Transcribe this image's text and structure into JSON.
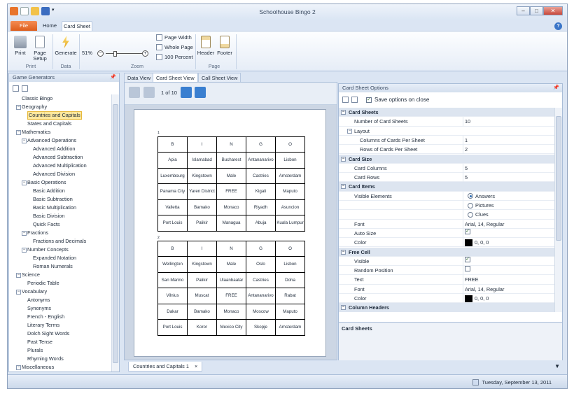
{
  "app": {
    "title": "Schoolhouse Bingo 2"
  },
  "window_controls": {
    "minimize": "–",
    "maximize": "□",
    "close": "✕"
  },
  "tabs": [
    "File",
    "Home",
    "Card Sheet"
  ],
  "help_label": "?",
  "ribbon": {
    "print": "Print",
    "page_setup": "Page Setup",
    "generate": "Generate",
    "zoom_value": "51%",
    "page_width": "Page Width",
    "whole_page": "Whole Page",
    "hundred": "100 Percent",
    "header": "Header",
    "footer": "Footer",
    "groups": {
      "print": "Print",
      "data": "Data",
      "zoom": "Zoom",
      "page": "Page"
    }
  },
  "left_panel": {
    "title": "Game Generators",
    "pin": "ᵖ",
    "tree": [
      {
        "label": "Classic Bingo",
        "level": 0,
        "toggle": ""
      },
      {
        "label": "Geography",
        "level": 0,
        "toggle": "−"
      },
      {
        "label": "Countries and Capitals",
        "level": 1,
        "toggle": "",
        "selected": true
      },
      {
        "label": "States and Capitals",
        "level": 1,
        "toggle": ""
      },
      {
        "label": "Mathematics",
        "level": 0,
        "toggle": "−"
      },
      {
        "label": "Advanced Operations",
        "level": 1,
        "toggle": "−"
      },
      {
        "label": "Advanced Addition",
        "level": 2,
        "toggle": ""
      },
      {
        "label": "Advanced Subtraction",
        "level": 2,
        "toggle": ""
      },
      {
        "label": "Advanced Multiplication",
        "level": 2,
        "toggle": ""
      },
      {
        "label": "Advanced Division",
        "level": 2,
        "toggle": ""
      },
      {
        "label": "Basic Operations",
        "level": 1,
        "toggle": "−"
      },
      {
        "label": "Basic Addition",
        "level": 2,
        "toggle": ""
      },
      {
        "label": "Basic Subtraction",
        "level": 2,
        "toggle": ""
      },
      {
        "label": "Basic Multiplication",
        "level": 2,
        "toggle": ""
      },
      {
        "label": "Basic Division",
        "level": 2,
        "toggle": ""
      },
      {
        "label": "Quick Facts",
        "level": 2,
        "toggle": ""
      },
      {
        "label": "Fractions",
        "level": 1,
        "toggle": "−"
      },
      {
        "label": "Fractions and Decimals",
        "level": 2,
        "toggle": ""
      },
      {
        "label": "Number Concepts",
        "level": 1,
        "toggle": "−"
      },
      {
        "label": "Expanded Notation",
        "level": 2,
        "toggle": ""
      },
      {
        "label": "Roman Numerals",
        "level": 2,
        "toggle": ""
      },
      {
        "label": "Science",
        "level": 0,
        "toggle": "−"
      },
      {
        "label": "Periodic Table",
        "level": 1,
        "toggle": ""
      },
      {
        "label": "Vocabulary",
        "level": 0,
        "toggle": "−"
      },
      {
        "label": "Antonyms",
        "level": 1,
        "toggle": ""
      },
      {
        "label": "Synonyms",
        "level": 1,
        "toggle": ""
      },
      {
        "label": "French - English",
        "level": 1,
        "toggle": ""
      },
      {
        "label": "Literary Terms",
        "level": 1,
        "toggle": ""
      },
      {
        "label": "Dolch Sight Words",
        "level": 1,
        "toggle": ""
      },
      {
        "label": "Past Tense",
        "level": 1,
        "toggle": ""
      },
      {
        "label": "Plurals",
        "level": 1,
        "toggle": ""
      },
      {
        "label": "Rhyming Words",
        "level": 1,
        "toggle": ""
      },
      {
        "label": "Miscellaneous",
        "level": 0,
        "toggle": "−"
      }
    ]
  },
  "doc_tabs": [
    "Data View",
    "Card Sheet View",
    "Call Sheet View"
  ],
  "viewer": {
    "page_info": "1 of 10",
    "card1_num": "1",
    "card2_num": "2",
    "header": [
      "B",
      "I",
      "N",
      "G",
      "O"
    ],
    "card1": [
      [
        "Apia",
        "Islamabad",
        "Bucharest",
        "Antananarivo",
        "Lisbon"
      ],
      [
        "Luxembourg",
        "Kingstown",
        "Male",
        "Castries",
        "Amsterdam"
      ],
      [
        "Panama City",
        "Yaren District",
        "FREE",
        "Kigali",
        "Maputo"
      ],
      [
        "Valletta",
        "Bamako",
        "Monaco",
        "Riyadh",
        "Asuncion"
      ],
      [
        "Port Louis",
        "Palikir",
        "Managua",
        "Abuja",
        "Kuala Lumpur"
      ]
    ],
    "card2": [
      [
        "Wellington",
        "Kingstown",
        "Male",
        "Oslo",
        "Lisbon"
      ],
      [
        "San Marino",
        "Palikir",
        "Ulaanbaatar",
        "Castries",
        "Doha"
      ],
      [
        "Vilnius",
        "Muscat",
        "FREE",
        "Antananarivo",
        "Rabat"
      ],
      [
        "Dakar",
        "Bamako",
        "Monaco",
        "Moscow",
        "Maputo"
      ],
      [
        "Port Louis",
        "Koror",
        "Mexico City",
        "Skopje",
        "Amsterdam"
      ]
    ]
  },
  "options": {
    "title": "Card Sheet Options",
    "save_label": "Save options on close",
    "rows": [
      {
        "type": "cat",
        "name": "Card Sheets"
      },
      {
        "type": "prop",
        "name": "Number of Card Sheets",
        "value": "10",
        "indent": 1
      },
      {
        "type": "sub",
        "name": "Layout"
      },
      {
        "type": "prop",
        "name": "Columns of Cards Per Sheet",
        "value": "1",
        "indent": 2
      },
      {
        "type": "prop",
        "name": "Rows of Cards Per Sheet",
        "value": "2",
        "indent": 2
      },
      {
        "type": "cat",
        "name": "Card Size"
      },
      {
        "type": "prop",
        "name": "Card Columns",
        "value": "5",
        "indent": 1
      },
      {
        "type": "prop",
        "name": "Card Rows",
        "value": "5",
        "indent": 1
      },
      {
        "type": "cat",
        "name": "Card Items"
      },
      {
        "type": "radio",
        "name": "Visible Elements",
        "value": "Answers",
        "on": true,
        "indent": 1
      },
      {
        "type": "radio",
        "name": "",
        "value": "Pictures",
        "on": false,
        "indent": 1
      },
      {
        "type": "radio",
        "name": "",
        "value": "Clues",
        "on": false,
        "indent": 1
      },
      {
        "type": "prop",
        "name": "Font",
        "value": "Arial, 14, Regular",
        "indent": 1
      },
      {
        "type": "check",
        "name": "Auto Size",
        "on": true,
        "indent": 1
      },
      {
        "type": "color",
        "name": "Color",
        "value": "0, 0, 0",
        "indent": 1
      },
      {
        "type": "cat",
        "name": "Free Cell"
      },
      {
        "type": "check",
        "name": "Visible",
        "on": true,
        "indent": 1
      },
      {
        "type": "check",
        "name": "Random Position",
        "on": false,
        "indent": 1
      },
      {
        "type": "prop",
        "name": "Text",
        "value": "FREE",
        "indent": 1
      },
      {
        "type": "prop",
        "name": "Font",
        "value": "Arial, 14, Regular",
        "indent": 1
      },
      {
        "type": "color",
        "name": "Color",
        "value": "0, 0, 0",
        "indent": 1
      },
      {
        "type": "cat",
        "name": "Column Headers"
      }
    ],
    "description_title": "Card Sheets"
  },
  "bottom_tab": {
    "label": "Countries and Capitals 1",
    "close": "×"
  },
  "status": {
    "date": "Tuesday, September 13, 2011"
  },
  "colors": {
    "file_tab": "#e06420",
    "selected": "#fde79c",
    "nav_blue": "#3a7fd0"
  }
}
